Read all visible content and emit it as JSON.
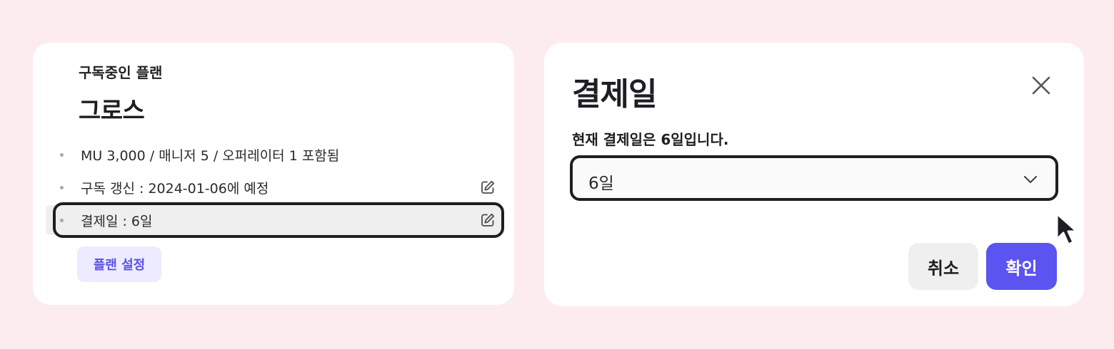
{
  "plan_card": {
    "label": "구독중인 플랜",
    "plan_name": "그로스",
    "items": [
      {
        "text": "MU 3,000 / 매니저 5 / 오퍼레이터 1 포함됨",
        "editable": false
      },
      {
        "text": "구독 갱신 : 2024-01-06에 예정",
        "editable": true,
        "icon": "pencil-square-icon"
      },
      {
        "text": "결제일 : 6일",
        "editable": true,
        "icon": "pencil-square-icon",
        "highlighted": true
      }
    ],
    "settings_button": "플랜 설정"
  },
  "dialog": {
    "title": "결제일",
    "close_icon": "close-icon",
    "description": "현재 결제일은 6일입니다.",
    "select": {
      "value": "6일",
      "icon": "chevron-down-icon"
    },
    "cancel_label": "취소",
    "confirm_label": "확인"
  },
  "colors": {
    "background": "#fdecef",
    "accent": "#5b54f0",
    "accent_soft": "#ecebff",
    "focus_outline": "#1f1f23"
  }
}
